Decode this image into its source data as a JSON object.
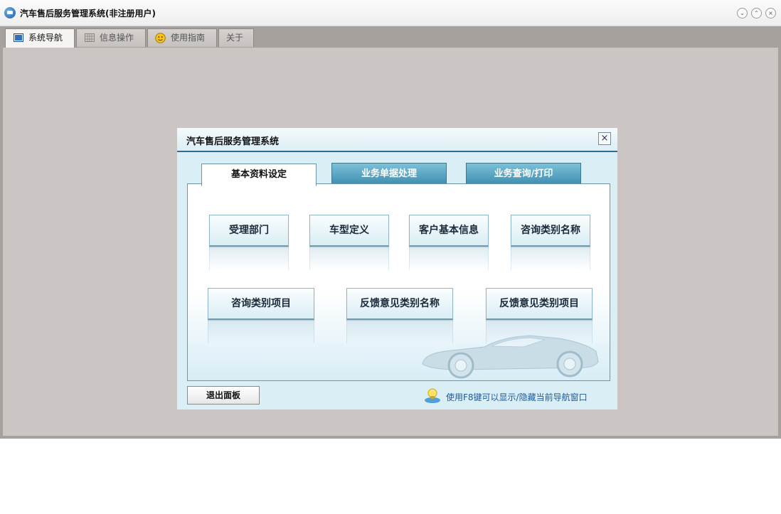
{
  "window": {
    "title": "汽车售后服务管理系统(非注册用户)",
    "controls": [
      "minimize",
      "maximize",
      "close"
    ]
  },
  "main_tabs": [
    {
      "label": "系统导航",
      "icon": "monitor-icon",
      "active": true
    },
    {
      "label": "信息操作",
      "icon": "grid-icon",
      "active": false
    },
    {
      "label": "使用指南",
      "icon": "help-face-icon",
      "active": false
    },
    {
      "label": "关于",
      "icon": "",
      "active": false
    }
  ],
  "dialog": {
    "title": "汽车售后服务管理系统",
    "subtabs": [
      {
        "label": "基本资料设定",
        "active": true
      },
      {
        "label": "业务单据处理",
        "active": false
      },
      {
        "label": "业务查询/打印",
        "active": false
      }
    ],
    "buttons": [
      {
        "label": "受理部门"
      },
      {
        "label": "车型定义"
      },
      {
        "label": "客户基本信息"
      },
      {
        "label": "咨询类别名称"
      },
      {
        "label": "咨询类别项目"
      },
      {
        "label": "反馈意见类别名称"
      },
      {
        "label": "反馈意见类别项目"
      }
    ],
    "exit_label": "退出面板",
    "tip": "使用F8键可以显示/隐藏当前导航窗口"
  },
  "colors": {
    "accent": "#3f8fb1",
    "workarea": "#cbc6c3",
    "tip_text": "#1c5a9c"
  }
}
